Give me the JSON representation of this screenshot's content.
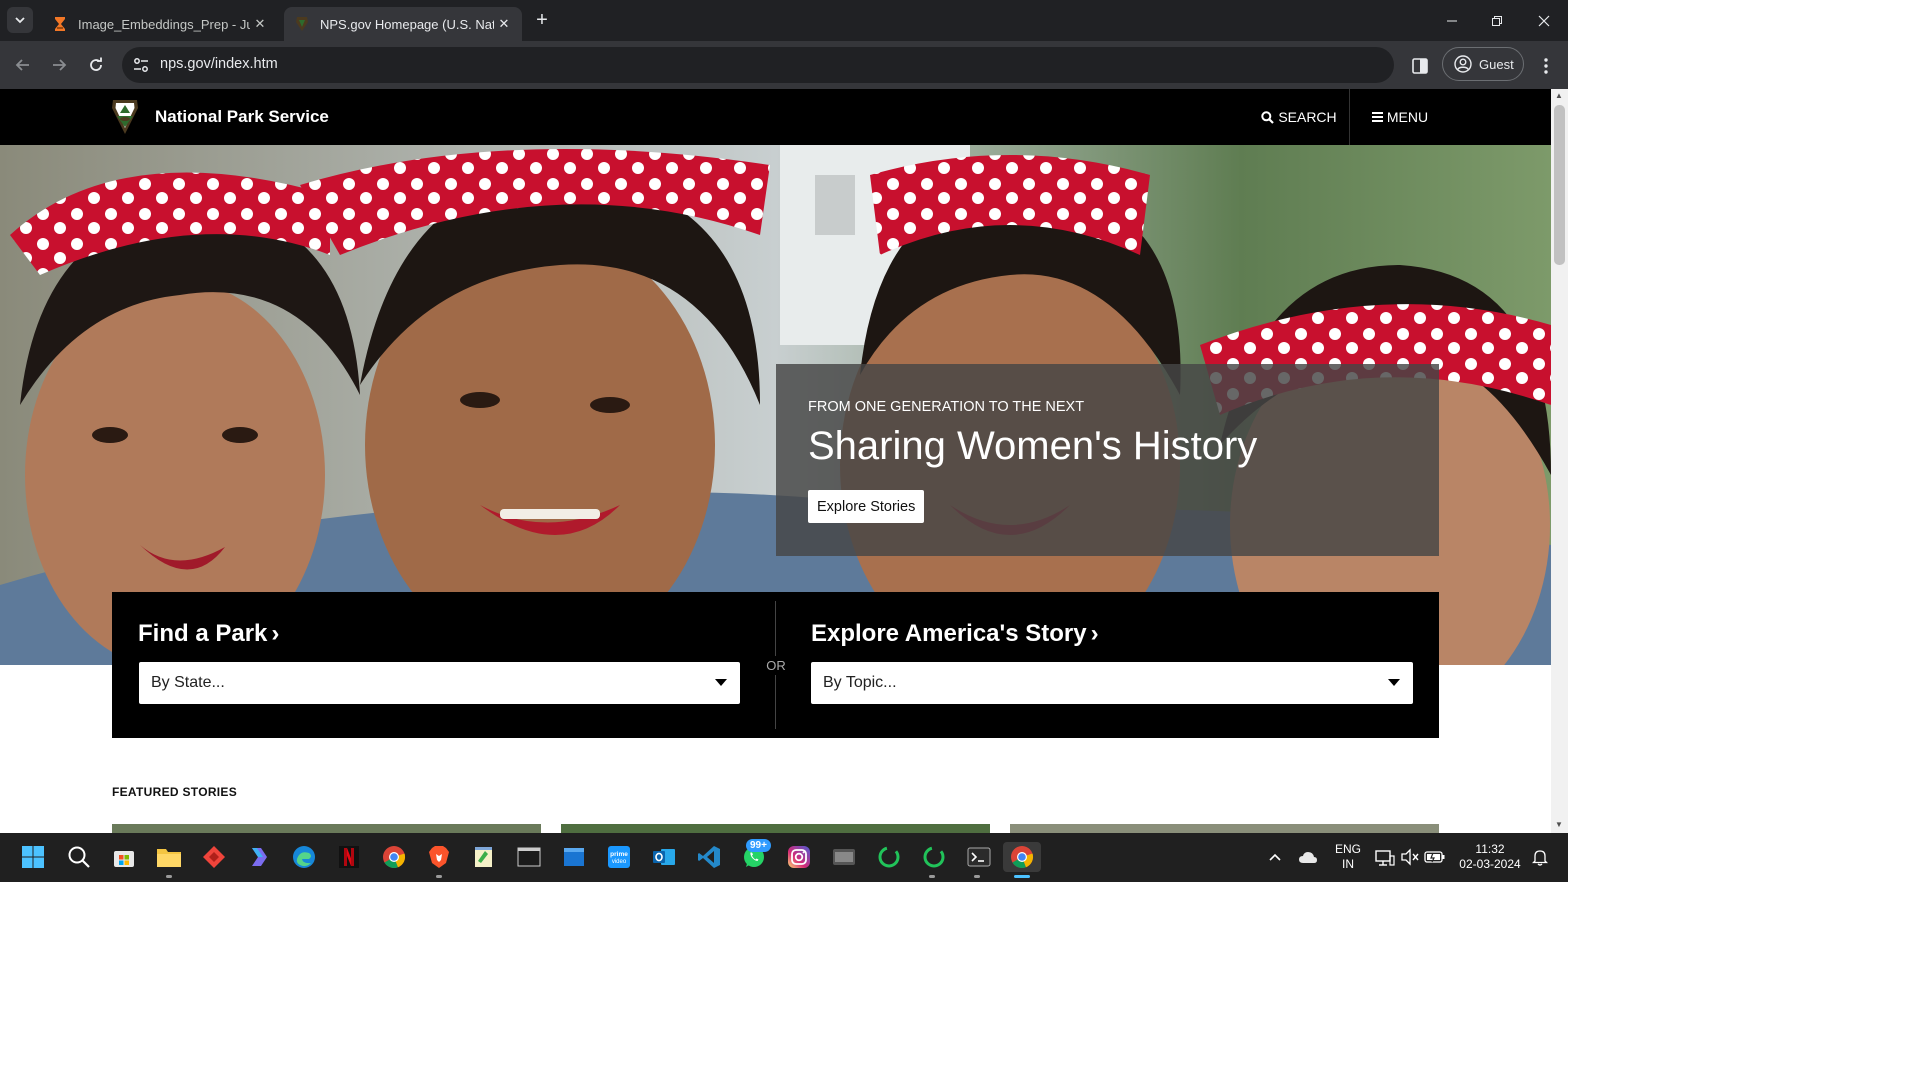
{
  "browser": {
    "tabs": [
      {
        "title": "Image_Embeddings_Prep - Jupy",
        "favicon": "hourglass-icon",
        "active": false
      },
      {
        "title": "NPS.gov Homepage (U.S. Natio",
        "favicon": "nps-arrowhead-icon",
        "active": true
      }
    ],
    "url": "nps.gov/index.htm",
    "profile_label": "Guest"
  },
  "site": {
    "name": "National Park Service",
    "search_label": "SEARCH",
    "menu_label": "MENU"
  },
  "hero": {
    "kicker": "FROM ONE GENERATION TO THE NEXT",
    "title": "Sharing Women's History",
    "button_label": "Explore Stories"
  },
  "finder": {
    "park_title": "Find a Park",
    "park_placeholder": "By State...",
    "or_label": "OR",
    "story_title": "Explore America's Story",
    "story_placeholder": "By Topic...",
    "chevron": "›"
  },
  "featured": {
    "label": "FEATURED STORIES"
  },
  "taskbar": {
    "apps": [
      "start-icon",
      "search-icon",
      "store-icon",
      "file-explorer-icon",
      "anydesk-icon",
      "copilot-icon",
      "edge-icon",
      "netflix-icon",
      "chrome-icon",
      "brave-icon",
      "notepad-icon",
      "terminal-icon",
      "window-icon",
      "prime-video-icon",
      "outlook-icon",
      "vscode-icon",
      "whatsapp-icon",
      "instagram-icon",
      "media-icon",
      "spinner-icon",
      "spinner-icon",
      "powershell-icon",
      "chrome-icon"
    ],
    "whatsapp_badge": "99+",
    "language_line1": "ENG",
    "language_line2": "IN",
    "time": "11:32",
    "date": "02-03-2024"
  },
  "colors": {
    "nps_header_bg": "#000000",
    "browser_dark": "#202124",
    "browser_toolbar": "#35363a",
    "taskbar_bg": "#202020",
    "accent_blue": "#4cc2ff"
  }
}
